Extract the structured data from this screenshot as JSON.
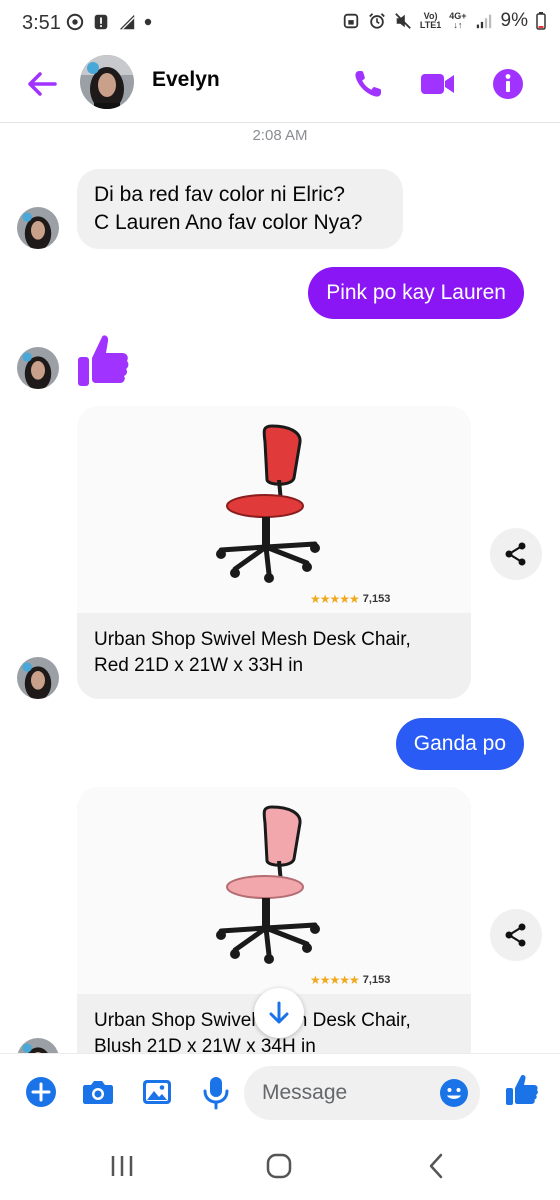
{
  "status_bar": {
    "time": "3:51",
    "network_top": "Vo)",
    "network_bottom": "LTE1",
    "network_type": "4G+",
    "battery": "9%"
  },
  "header": {
    "contact_name": "Evelyn",
    "icons": [
      "back-arrow-icon",
      "phone-icon",
      "video-icon",
      "info-icon"
    ]
  },
  "chat": {
    "timestamp": "2:08 AM",
    "msg1_line1": "Di ba red fav color ni Elric?",
    "msg1_line2": "C Lauren Ano fav color Nya?",
    "msg2": "Pink po kay Lauren",
    "msg3": "Ganda po",
    "product1": {
      "title_line1": "Urban Shop Swivel Mesh Desk Chair,",
      "title_line2": "Red 21D x 21W x 33H in",
      "stars": "★★★★★",
      "rating_count": "7,153",
      "chair_color": "#e03a3a"
    },
    "product2": {
      "title_line1": "Urban Shop Swivel Mesh Desk Chair,",
      "title_line2": "Blush 21D x 21W x 34H in",
      "stars": "★★★★★",
      "rating_count": "7,153",
      "chair_color": "#f2a7ad"
    }
  },
  "composer": {
    "placeholder": "Message"
  },
  "colors": {
    "accent_purple": "#a033ff",
    "outgoing_purple": "#8a16f5",
    "outgoing_blue": "#2a5cf5",
    "composer_blue": "#1a74e8"
  }
}
